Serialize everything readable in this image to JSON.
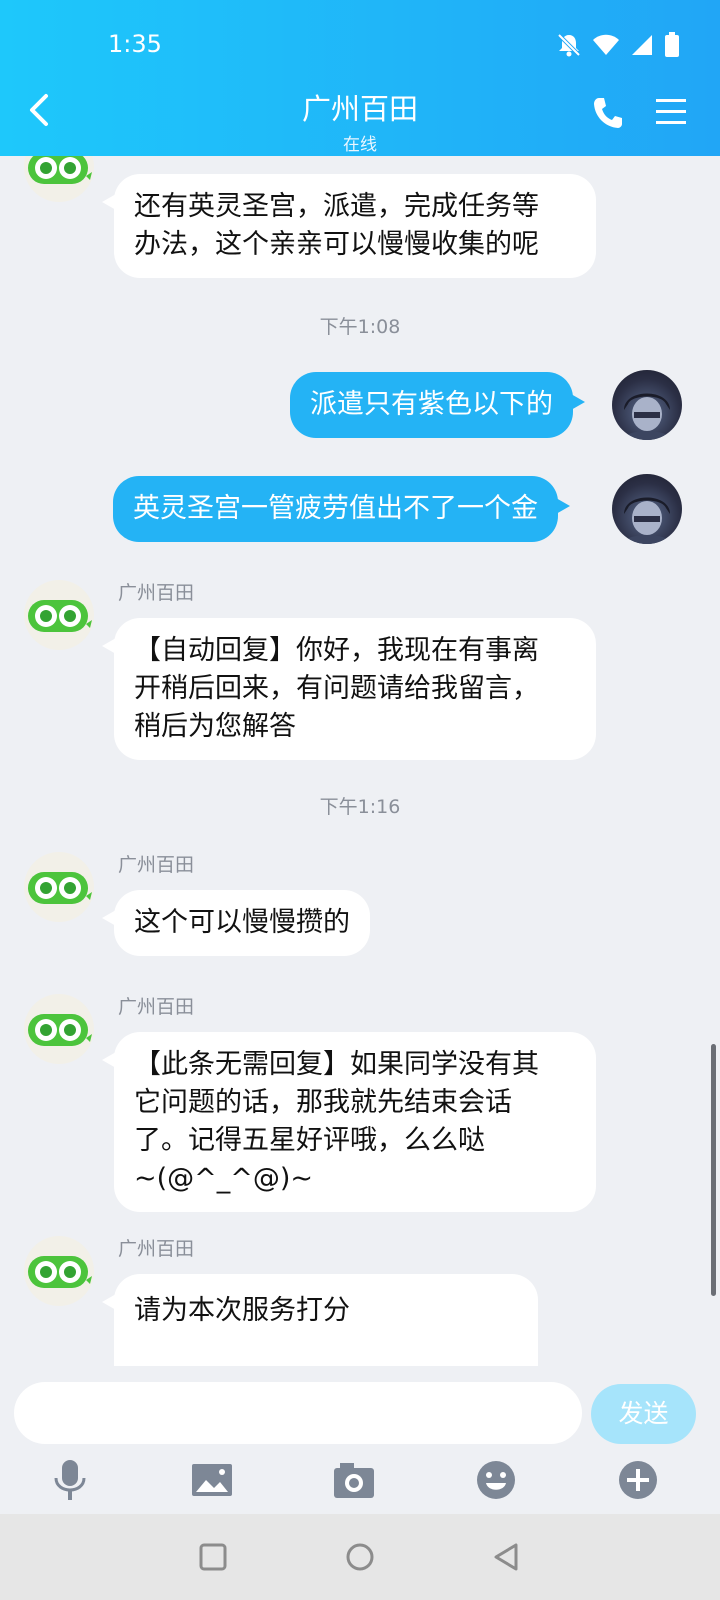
{
  "status_bar": {
    "time": "1:35"
  },
  "header": {
    "title": "广州百田",
    "subtitle": "在线"
  },
  "messages": [
    {
      "id": "m1",
      "from": "bot",
      "sender": "广州百田",
      "text": [
        "还有英灵圣宫，派遣，完成任务等",
        "办法，这个亲亲可以慢慢收集的呢"
      ]
    },
    {
      "id": "t1",
      "type": "time",
      "text": "下午1:08"
    },
    {
      "id": "m2",
      "from": "me",
      "text": [
        "派遣只有紫色以下的"
      ]
    },
    {
      "id": "m3",
      "from": "me",
      "text": [
        "英灵圣宫一管疲劳值出不了一个金"
      ]
    },
    {
      "id": "m4",
      "from": "bot",
      "sender": "广州百田",
      "text": [
        "【自动回复】你好，我现在有事离",
        "开稍后回来，有问题请给我留言，",
        "稍后为您解答"
      ]
    },
    {
      "id": "t2",
      "type": "time",
      "text": "下午1:16"
    },
    {
      "id": "m5",
      "from": "bot",
      "sender": "广州百田",
      "text": [
        "这个可以慢慢攒的"
      ]
    },
    {
      "id": "m6",
      "from": "bot",
      "sender": "广州百田",
      "text": [
        "【此条无需回复】如果同学没有其",
        "它问题的话，那我就先结束会话",
        "了。记得五星好评哦，么么哒",
        "~(@^_^@)~"
      ]
    },
    {
      "id": "m7",
      "from": "bot",
      "sender": "广州百田",
      "text": [
        "请为本次服务打分"
      ]
    }
  ],
  "composer": {
    "input_value": "",
    "send_label": "发送"
  },
  "colors": {
    "header_start": "#1ec8fb",
    "header_end": "#21a6f6",
    "outgoing_bubble": "#24b3f5",
    "send_disabled": "#a6e4fb"
  },
  "toolbar_icons": [
    "microphone-icon",
    "image-icon",
    "camera-icon",
    "emoji-icon",
    "plus-icon"
  ],
  "nav_icons": [
    "recents-icon",
    "home-icon",
    "back-icon"
  ]
}
